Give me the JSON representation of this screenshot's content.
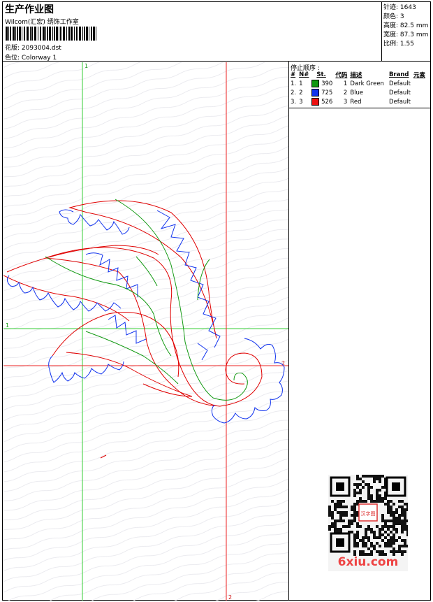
{
  "header": {
    "title": "生产作业图",
    "company": "Wilcom(汇宏) 绣饰工作室",
    "design_label": "花版:",
    "design_value": "2093004.dst",
    "colorway_label": "色位:",
    "colorway_value": "Colorway 1"
  },
  "stats": {
    "stitches_label": "针迹:",
    "stitches": "1643",
    "colors_label": "颜色:",
    "colors": "3",
    "height_label": "高度:",
    "height": "82.5 mm",
    "width_label": "宽度:",
    "width": "87.3 mm",
    "scale_label": "比例:",
    "scale": "1.55"
  },
  "stop_sequence": {
    "title": "停止顺序 :",
    "columns": [
      "#",
      "N#",
      "St.",
      "代码",
      "描述",
      "Brand",
      "元素"
    ],
    "rows": [
      {
        "index": "1.",
        "needle": "1",
        "color": "#119911",
        "stitches": "390",
        "code": "1",
        "description": "Dark Green",
        "brand": "Default"
      },
      {
        "index": "2.",
        "needle": "2",
        "color": "#1133ee",
        "stitches": "725",
        "code": "2",
        "description": "Blue",
        "brand": "Default"
      },
      {
        "index": "3.",
        "needle": "3",
        "color": "#ee1111",
        "stitches": "526",
        "code": "3",
        "description": "Red",
        "brand": "Default"
      }
    ]
  },
  "canvas": {
    "guide_labels": {
      "v_green": "1",
      "h_green": "1",
      "h_red": "2",
      "v_red": "2"
    }
  },
  "watermark": {
    "text": "6xiu.com",
    "seal_text": "汉字图"
  }
}
